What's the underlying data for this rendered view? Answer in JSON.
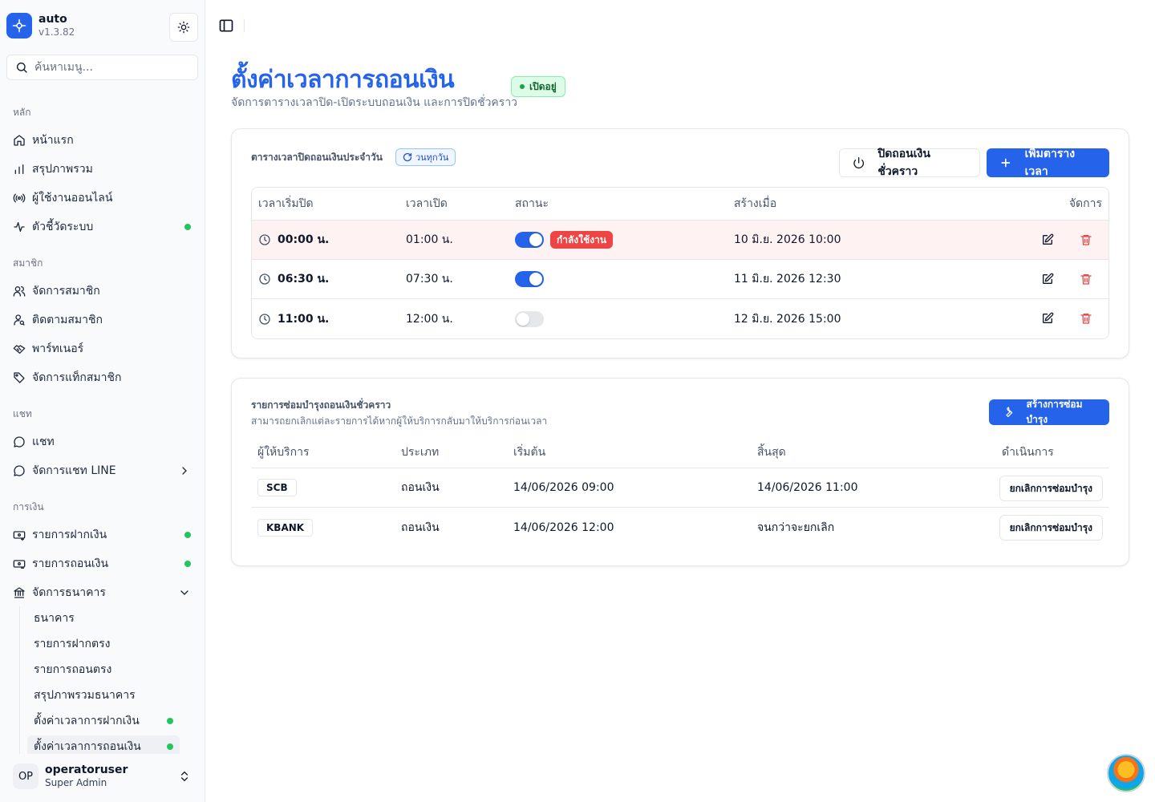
{
  "app": {
    "name": "auto",
    "version": "v1.3.82"
  },
  "sidebar": {
    "search_placeholder": "ค้นหาเมนู...",
    "groups": [
      {
        "label": "หลัก",
        "items": [
          {
            "label": "หน้าแรก",
            "icon": "home-icon"
          },
          {
            "label": "สรุปภาพรวม",
            "icon": "bar-chart-icon"
          },
          {
            "label": "ผู้ใช้งานออนไลน์",
            "icon": "radio-icon"
          },
          {
            "label": "ตัวชี้วัดระบบ",
            "icon": "activity-icon",
            "dot": true
          }
        ]
      },
      {
        "label": "สมาชิก",
        "items": [
          {
            "label": "จัดการสมาชิก",
            "icon": "users-icon"
          },
          {
            "label": "ติดตามสมาชิก",
            "icon": "user-search-icon"
          },
          {
            "label": "พาร์ทเนอร์",
            "icon": "handshake-icon"
          },
          {
            "label": "จัดการแท็กสมาชิก",
            "icon": "tag-icon"
          }
        ]
      },
      {
        "label": "แชท",
        "items": [
          {
            "label": "แชท",
            "icon": "chat-icon"
          },
          {
            "label": "จัดการแชท LINE",
            "icon": "chat-icon",
            "chevron": "right"
          }
        ]
      },
      {
        "label": "การเงิน",
        "items": [
          {
            "label": "รายการฝากเงิน",
            "icon": "deposit-icon",
            "dot": true
          },
          {
            "label": "รายการถอนเงิน",
            "icon": "withdraw-icon",
            "dot": true
          },
          {
            "label": "จัดการธนาคาร",
            "icon": "bank-icon",
            "chevron": "down"
          }
        ]
      }
    ],
    "bank_sub_items": [
      {
        "label": "ธนาคาร"
      },
      {
        "label": "รายการฝากตรง"
      },
      {
        "label": "รายการถอนตรง"
      },
      {
        "label": "สรุปภาพรวมธนาคาร"
      },
      {
        "label": "ตั้งค่าเวลาการฝากเงิน",
        "dot": true
      },
      {
        "label": "ตั้งค่าเวลาการถอนเงิน",
        "dot": true,
        "active": true
      }
    ],
    "user": {
      "initials": "OP",
      "name": "operatoruser",
      "role": "Super Admin"
    }
  },
  "page": {
    "title": "ตั้งค่าเวลาการถอนเงิน",
    "subtitle": "จัดการตารางเวลาปิด-เปิดระบบถอนเงิน และการปิดชั่วคราว",
    "status": "เปิดอยู่"
  },
  "schedule": {
    "title": "ตารางเวลาปิดถอนเงินประจำวัน",
    "repeat_badge": "วนทุกวัน",
    "pause_button": "ปิดถอนเงินชั่วคราว",
    "add_button": "เพิ่มตารางเวลา",
    "columns": [
      "เวลาเริ่มปิด",
      "เวลาเปิด",
      "สถานะ",
      "สร้างเมื่อ",
      "จัดการ"
    ],
    "active_label": "กำลังใช้งาน",
    "rows": [
      {
        "start": "00:00 น.",
        "end": "01:00 น.",
        "enabled": true,
        "active": true,
        "created": "10 มิ.ย. 2026 10:00"
      },
      {
        "start": "06:30 น.",
        "end": "07:30 น.",
        "enabled": true,
        "active": false,
        "created": "11 มิ.ย. 2026 12:30"
      },
      {
        "start": "11:00 น.",
        "end": "12:00 น.",
        "enabled": false,
        "active": false,
        "created": "12 มิ.ย. 2026 15:00"
      }
    ]
  },
  "maintenance": {
    "title": "รายการซ่อมบำรุงถอนเงินชั่วคราว",
    "subtitle": "สามารถยกเลิกแต่ละรายการได้หากผู้ให้บริการกลับมาให้บริการก่อนเวลา",
    "create_button": "สร้างการซ่อมบำรุง",
    "columns": [
      "ผู้ให้บริการ",
      "ประเภท",
      "เริ่มต้น",
      "สิ้นสุด",
      "ดำเนินการ"
    ],
    "cancel_label": "ยกเลิกการซ่อมบำรุง",
    "rows": [
      {
        "provider": "SCB",
        "type": "ถอนเงิน",
        "start": "14/06/2026 09:00",
        "end": "14/06/2026 11:00"
      },
      {
        "provider": "KBANK",
        "type": "ถอนเงิน",
        "start": "14/06/2026 12:00",
        "end": "จนกว่าจะยกเลิก"
      }
    ]
  },
  "colors": {
    "primary": "#2563eb",
    "success": "#22c55e",
    "danger": "#ef4444",
    "active_row": "#fef2f2"
  }
}
